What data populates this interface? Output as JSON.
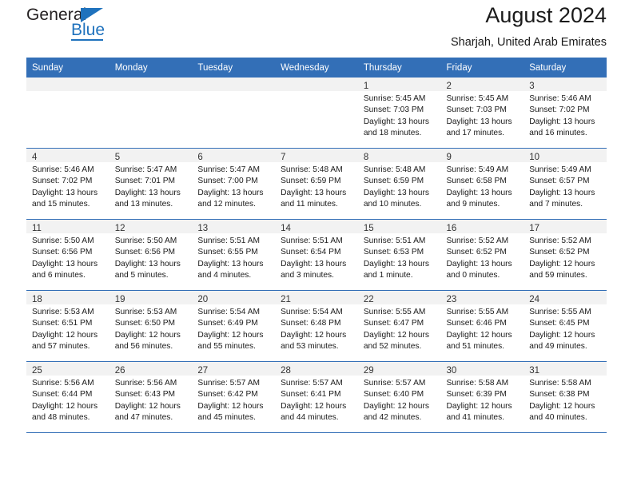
{
  "brand": {
    "name_top": "General",
    "name_bottom": "Blue"
  },
  "header": {
    "title": "August 2024",
    "subtitle": "Sharjah, United Arab Emirates"
  },
  "colors": {
    "header_blue": "#336fb7",
    "brand_blue": "#1f72bd",
    "daynum_band": "#f2f2f2",
    "text": "#1a1a1a"
  },
  "weekdays": [
    "Sunday",
    "Monday",
    "Tuesday",
    "Wednesday",
    "Thursday",
    "Friday",
    "Saturday"
  ],
  "labels": {
    "sunrise_prefix": "Sunrise:",
    "sunset_prefix": "Sunset:",
    "daylight_prefix": "Daylight:"
  },
  "weeks": [
    [
      {
        "day": "",
        "lines": []
      },
      {
        "day": "",
        "lines": []
      },
      {
        "day": "",
        "lines": []
      },
      {
        "day": "",
        "lines": []
      },
      {
        "day": "1",
        "lines": [
          "Sunrise: 5:45 AM",
          "Sunset: 7:03 PM",
          "Daylight: 13 hours",
          "and 18 minutes."
        ]
      },
      {
        "day": "2",
        "lines": [
          "Sunrise: 5:45 AM",
          "Sunset: 7:03 PM",
          "Daylight: 13 hours",
          "and 17 minutes."
        ]
      },
      {
        "day": "3",
        "lines": [
          "Sunrise: 5:46 AM",
          "Sunset: 7:02 PM",
          "Daylight: 13 hours",
          "and 16 minutes."
        ]
      }
    ],
    [
      {
        "day": "4",
        "lines": [
          "Sunrise: 5:46 AM",
          "Sunset: 7:02 PM",
          "Daylight: 13 hours",
          "and 15 minutes."
        ]
      },
      {
        "day": "5",
        "lines": [
          "Sunrise: 5:47 AM",
          "Sunset: 7:01 PM",
          "Daylight: 13 hours",
          "and 13 minutes."
        ]
      },
      {
        "day": "6",
        "lines": [
          "Sunrise: 5:47 AM",
          "Sunset: 7:00 PM",
          "Daylight: 13 hours",
          "and 12 minutes."
        ]
      },
      {
        "day": "7",
        "lines": [
          "Sunrise: 5:48 AM",
          "Sunset: 6:59 PM",
          "Daylight: 13 hours",
          "and 11 minutes."
        ]
      },
      {
        "day": "8",
        "lines": [
          "Sunrise: 5:48 AM",
          "Sunset: 6:59 PM",
          "Daylight: 13 hours",
          "and 10 minutes."
        ]
      },
      {
        "day": "9",
        "lines": [
          "Sunrise: 5:49 AM",
          "Sunset: 6:58 PM",
          "Daylight: 13 hours",
          "and 9 minutes."
        ]
      },
      {
        "day": "10",
        "lines": [
          "Sunrise: 5:49 AM",
          "Sunset: 6:57 PM",
          "Daylight: 13 hours",
          "and 7 minutes."
        ]
      }
    ],
    [
      {
        "day": "11",
        "lines": [
          "Sunrise: 5:50 AM",
          "Sunset: 6:56 PM",
          "Daylight: 13 hours",
          "and 6 minutes."
        ]
      },
      {
        "day": "12",
        "lines": [
          "Sunrise: 5:50 AM",
          "Sunset: 6:56 PM",
          "Daylight: 13 hours",
          "and 5 minutes."
        ]
      },
      {
        "day": "13",
        "lines": [
          "Sunrise: 5:51 AM",
          "Sunset: 6:55 PM",
          "Daylight: 13 hours",
          "and 4 minutes."
        ]
      },
      {
        "day": "14",
        "lines": [
          "Sunrise: 5:51 AM",
          "Sunset: 6:54 PM",
          "Daylight: 13 hours",
          "and 3 minutes."
        ]
      },
      {
        "day": "15",
        "lines": [
          "Sunrise: 5:51 AM",
          "Sunset: 6:53 PM",
          "Daylight: 13 hours",
          "and 1 minute."
        ]
      },
      {
        "day": "16",
        "lines": [
          "Sunrise: 5:52 AM",
          "Sunset: 6:52 PM",
          "Daylight: 13 hours",
          "and 0 minutes."
        ]
      },
      {
        "day": "17",
        "lines": [
          "Sunrise: 5:52 AM",
          "Sunset: 6:52 PM",
          "Daylight: 12 hours",
          "and 59 minutes."
        ]
      }
    ],
    [
      {
        "day": "18",
        "lines": [
          "Sunrise: 5:53 AM",
          "Sunset: 6:51 PM",
          "Daylight: 12 hours",
          "and 57 minutes."
        ]
      },
      {
        "day": "19",
        "lines": [
          "Sunrise: 5:53 AM",
          "Sunset: 6:50 PM",
          "Daylight: 12 hours",
          "and 56 minutes."
        ]
      },
      {
        "day": "20",
        "lines": [
          "Sunrise: 5:54 AM",
          "Sunset: 6:49 PM",
          "Daylight: 12 hours",
          "and 55 minutes."
        ]
      },
      {
        "day": "21",
        "lines": [
          "Sunrise: 5:54 AM",
          "Sunset: 6:48 PM",
          "Daylight: 12 hours",
          "and 53 minutes."
        ]
      },
      {
        "day": "22",
        "lines": [
          "Sunrise: 5:55 AM",
          "Sunset: 6:47 PM",
          "Daylight: 12 hours",
          "and 52 minutes."
        ]
      },
      {
        "day": "23",
        "lines": [
          "Sunrise: 5:55 AM",
          "Sunset: 6:46 PM",
          "Daylight: 12 hours",
          "and 51 minutes."
        ]
      },
      {
        "day": "24",
        "lines": [
          "Sunrise: 5:55 AM",
          "Sunset: 6:45 PM",
          "Daylight: 12 hours",
          "and 49 minutes."
        ]
      }
    ],
    [
      {
        "day": "25",
        "lines": [
          "Sunrise: 5:56 AM",
          "Sunset: 6:44 PM",
          "Daylight: 12 hours",
          "and 48 minutes."
        ]
      },
      {
        "day": "26",
        "lines": [
          "Sunrise: 5:56 AM",
          "Sunset: 6:43 PM",
          "Daylight: 12 hours",
          "and 47 minutes."
        ]
      },
      {
        "day": "27",
        "lines": [
          "Sunrise: 5:57 AM",
          "Sunset: 6:42 PM",
          "Daylight: 12 hours",
          "and 45 minutes."
        ]
      },
      {
        "day": "28",
        "lines": [
          "Sunrise: 5:57 AM",
          "Sunset: 6:41 PM",
          "Daylight: 12 hours",
          "and 44 minutes."
        ]
      },
      {
        "day": "29",
        "lines": [
          "Sunrise: 5:57 AM",
          "Sunset: 6:40 PM",
          "Daylight: 12 hours",
          "and 42 minutes."
        ]
      },
      {
        "day": "30",
        "lines": [
          "Sunrise: 5:58 AM",
          "Sunset: 6:39 PM",
          "Daylight: 12 hours",
          "and 41 minutes."
        ]
      },
      {
        "day": "31",
        "lines": [
          "Sunrise: 5:58 AM",
          "Sunset: 6:38 PM",
          "Daylight: 12 hours",
          "and 40 minutes."
        ]
      }
    ]
  ]
}
